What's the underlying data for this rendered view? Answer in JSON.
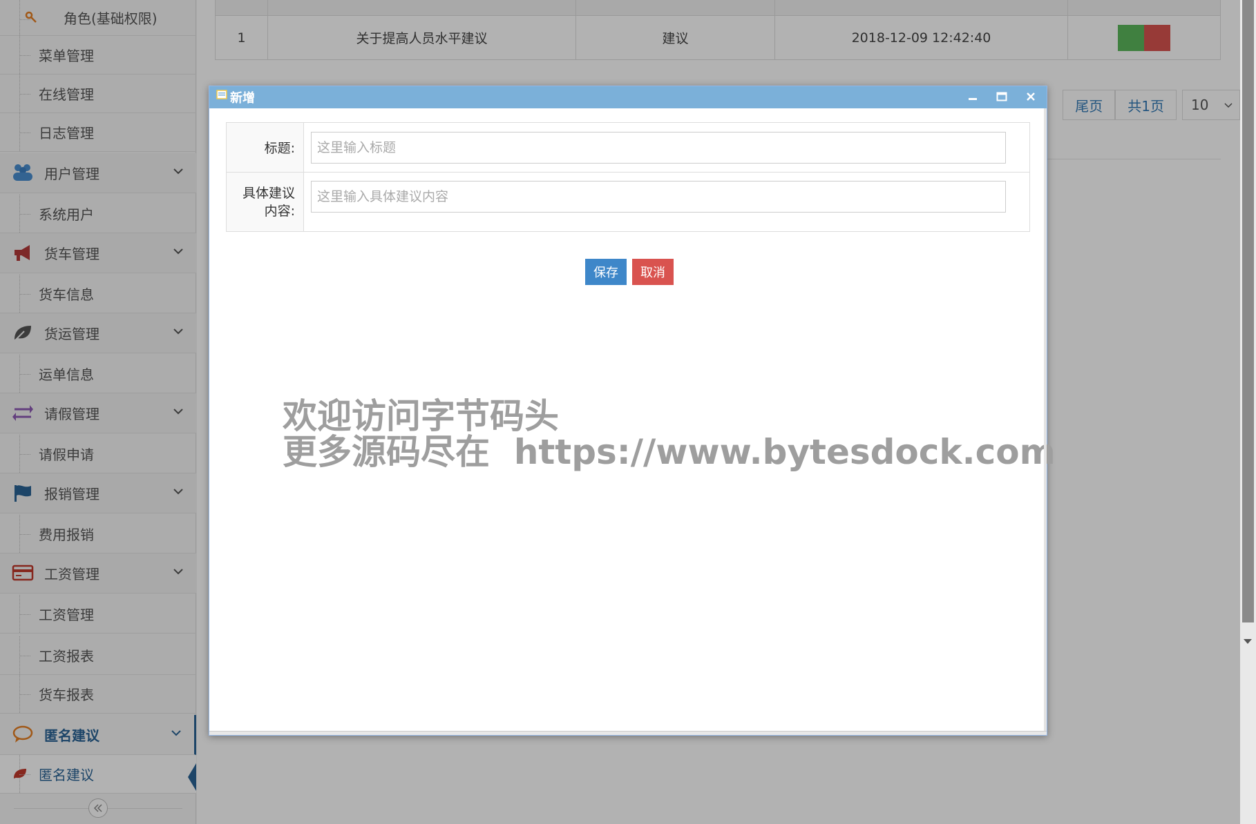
{
  "sidebar": {
    "items": [
      {
        "label": "角色(基础权限)"
      },
      {
        "label": "菜单管理"
      },
      {
        "label": "在线管理"
      },
      {
        "label": "日志管理"
      },
      {
        "label": "用户管理"
      },
      {
        "label": "系统用户"
      },
      {
        "label": "货车管理"
      },
      {
        "label": "货车信息"
      },
      {
        "label": "货运管理"
      },
      {
        "label": "运单信息"
      },
      {
        "label": "请假管理"
      },
      {
        "label": "请假申请"
      },
      {
        "label": "报销管理"
      },
      {
        "label": "费用报销"
      },
      {
        "label": "工资管理"
      },
      {
        "label": "工资管理"
      },
      {
        "label": "工资报表"
      },
      {
        "label": "货车报表"
      },
      {
        "label": "匿名建议"
      },
      {
        "label": "匿名建议"
      }
    ]
  },
  "table": {
    "rows": [
      {
        "index": "1",
        "title": "关于提高人员水平建议",
        "content": "建议",
        "time": "2018-12-09 12:42:40"
      }
    ]
  },
  "pager": {
    "last": "尾页",
    "total": "共1页",
    "size": "10"
  },
  "dialog": {
    "title": "新增",
    "title_label": "标题:",
    "title_placeholder": "这里输入标题",
    "content_label_1": "具体建议",
    "content_label_2": "内容:",
    "content_placeholder": "这里输入具体建议内容",
    "save": "保存",
    "cancel": "取消"
  },
  "watermark": {
    "line1": "欢迎访问字节码头",
    "line2": "更多源码尽在  https://www.bytesdock.com"
  },
  "colors": {
    "accent": "#2a6496",
    "dialog_header": "#7bb0d9",
    "save": "#3e87c9",
    "cancel": "#d9534f",
    "edit": "#5cb85c"
  }
}
